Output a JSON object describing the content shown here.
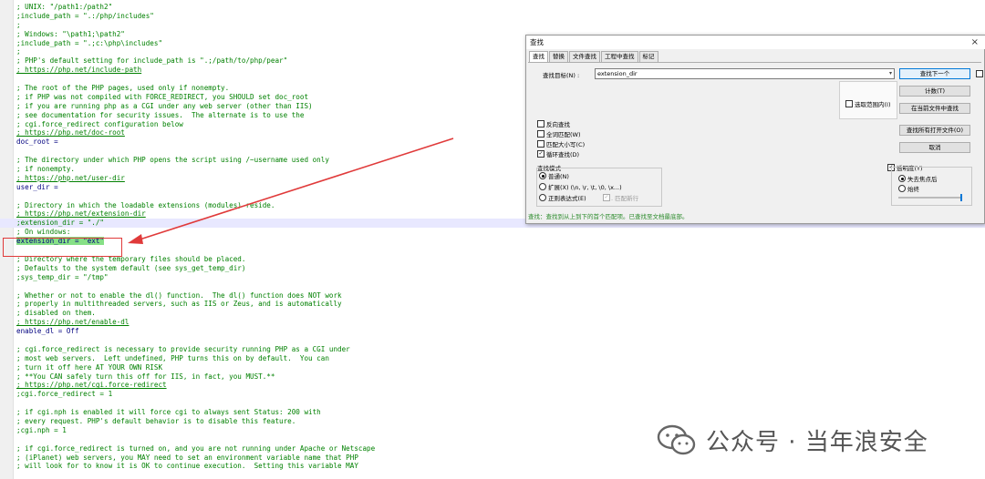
{
  "editor": {
    "lines": [
      {
        "t": "; UNIX: \"/path1:/path2\"",
        "k": "c"
      },
      {
        "t": ";include_path = \".:/php/includes\"",
        "k": "c"
      },
      {
        "t": ";",
        "k": "c"
      },
      {
        "t": "; Windows: \"\\path1;\\path2\"",
        "k": "c"
      },
      {
        "t": ";include_path = \".;c:\\php\\includes\"",
        "k": "c"
      },
      {
        "t": ";",
        "k": "c"
      },
      {
        "t": "; PHP's default setting for include_path is \".;/path/to/php/pear\"",
        "k": "c"
      },
      {
        "t": "; https://php.net/include-path",
        "k": "link"
      },
      {
        "t": "",
        "k": "c"
      },
      {
        "t": "; The root of the PHP pages, used only if nonempty.",
        "k": "c"
      },
      {
        "t": "; if PHP was not compiled with FORCE_REDIRECT, you SHOULD set doc_root",
        "k": "c"
      },
      {
        "t": "; if you are running php as a CGI under any web server (other than IIS)",
        "k": "c"
      },
      {
        "t": "; see documentation for security issues.  The alternate is to use the",
        "k": "c"
      },
      {
        "t": "; cgi.force_redirect configuration below",
        "k": "c"
      },
      {
        "t": "; https://php.net/doc-root",
        "k": "link"
      },
      {
        "t": "doc_root =",
        "k": "key"
      },
      {
        "t": "",
        "k": "c"
      },
      {
        "t": "; The directory under which PHP opens the script using /~username used only",
        "k": "c"
      },
      {
        "t": "; if nonempty.",
        "k": "c"
      },
      {
        "t": "; https://php.net/user-dir",
        "k": "link"
      },
      {
        "t": "user_dir =",
        "k": "key"
      },
      {
        "t": "",
        "k": "c"
      },
      {
        "t": "; Directory in which the loadable extensions (modules) reside.",
        "k": "c"
      },
      {
        "t": "; https://php.net/extension-dir",
        "k": "link"
      },
      {
        "t": ";extension_dir = \"./\"",
        "k": "hl"
      },
      {
        "t": "; On windows:",
        "k": "c"
      },
      {
        "t": "extension_dir = \"ext\"",
        "k": "mark"
      },
      {
        "t": "",
        "k": "c"
      },
      {
        "t": "; Directory where the temporary files should be placed.",
        "k": "c"
      },
      {
        "t": "; Defaults to the system default (see sys_get_temp_dir)",
        "k": "c"
      },
      {
        "t": ";sys_temp_dir = \"/tmp\"",
        "k": "c"
      },
      {
        "t": "",
        "k": "c"
      },
      {
        "t": "; Whether or not to enable the dl() function.  The dl() function does NOT work",
        "k": "c"
      },
      {
        "t": "; properly in multithreaded servers, such as IIS or Zeus, and is automatically",
        "k": "c"
      },
      {
        "t": "; disabled on them.",
        "k": "c"
      },
      {
        "t": "; https://php.net/enable-dl",
        "k": "link"
      },
      {
        "t": "enable_dl = Off",
        "k": "key"
      },
      {
        "t": "",
        "k": "c"
      },
      {
        "t": "; cgi.force_redirect is necessary to provide security running PHP as a CGI under",
        "k": "c"
      },
      {
        "t": "; most web servers.  Left undefined, PHP turns this on by default.  You can",
        "k": "c"
      },
      {
        "t": "; turn it off here AT YOUR OWN RISK",
        "k": "c"
      },
      {
        "t": "; **You CAN safely turn this off for IIS, in fact, you MUST.**",
        "k": "c"
      },
      {
        "t": "; https://php.net/cgi.force-redirect",
        "k": "link"
      },
      {
        "t": ";cgi.force_redirect = 1",
        "k": "c"
      },
      {
        "t": "",
        "k": "c"
      },
      {
        "t": "; if cgi.nph is enabled it will force cgi to always sent Status: 200 with",
        "k": "c"
      },
      {
        "t": "; every request. PHP's default behavior is to disable this feature.",
        "k": "c"
      },
      {
        "t": ";cgi.nph = 1",
        "k": "c"
      },
      {
        "t": "",
        "k": "c"
      },
      {
        "t": "; if cgi.force_redirect is turned on, and you are not running under Apache or Netscape",
        "k": "c"
      },
      {
        "t": "; (iPlanet) web servers, you MAY need to set an environment variable name that PHP",
        "k": "c"
      },
      {
        "t": "; will look for to know it is OK to continue execution.  Setting this variable MAY",
        "k": "c"
      }
    ]
  },
  "find_dialog": {
    "title": "查找",
    "close": "×",
    "tabs": [
      "查找",
      "替换",
      "文件查找",
      "工程中查找",
      "标记"
    ],
    "target_label": "查找目标(N) :",
    "target_value": "extension_dir",
    "buttons": {
      "find_next": "查找下一个",
      "count": "计数(T)",
      "find_in_current": "在当前文件中查找",
      "find_all_open": "查找所有打开文件(O)",
      "cancel": "取消"
    },
    "in_selection": "选取范围内(I)",
    "options": [
      {
        "label": "反向查找",
        "checked": false
      },
      {
        "label": "全词匹配(W)",
        "checked": false
      },
      {
        "label": "匹配大小写(C)",
        "checked": false
      },
      {
        "label": "循环查找(D)",
        "checked": true
      }
    ],
    "search_mode": {
      "title": "查找模式",
      "modes": [
        {
          "label": "普通(N)",
          "on": true
        },
        {
          "label": "扩展(X) (\\n, \\r, \\t, \\0, \\x...)",
          "on": false
        },
        {
          "label": "正则表达式(E)",
          "on": false
        }
      ],
      "dot_newline": ". 匹配新行"
    },
    "transparency": {
      "label": "透明度(Y)",
      "checked": true,
      "lose_focus": "失去焦点后",
      "always": "始终"
    },
    "status": "查找：查找到从上到下的首个匹配项。已查找至文档最底部。"
  },
  "watermark": {
    "text": "公众号 · 当年浪安全",
    "icon": "wechat-icon",
    "color": "#555555"
  }
}
